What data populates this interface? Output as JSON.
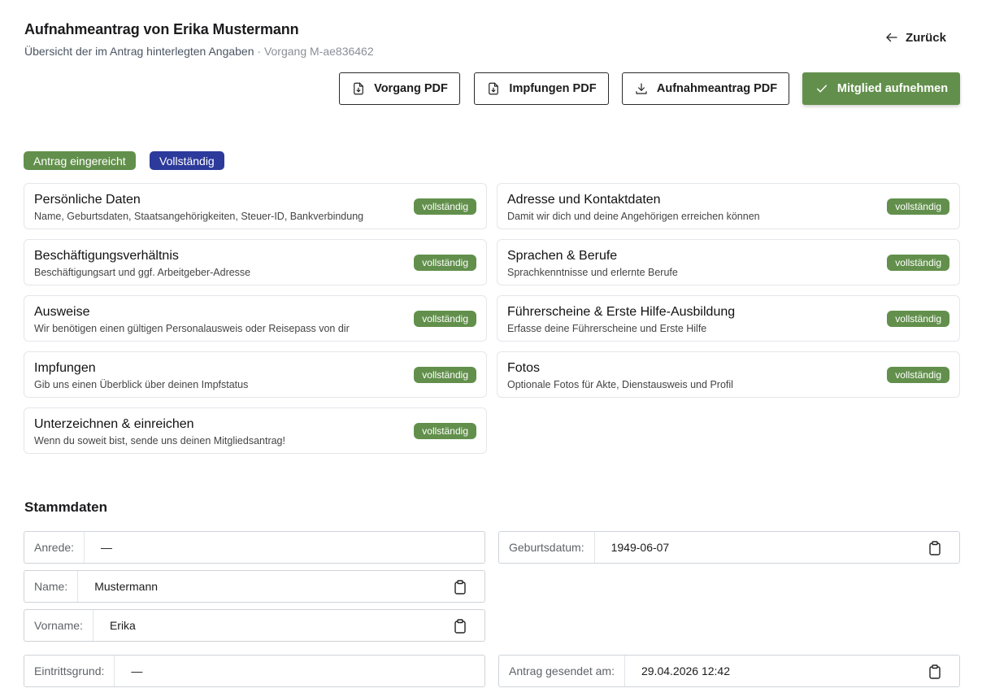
{
  "header": {
    "title": "Aufnahmeantrag von Erika Mustermann",
    "subtitle": "Übersicht der im Antrag hinterlegten Angaben",
    "reference": "· Vorgang M-ae836462",
    "back_label": "Zurück"
  },
  "actions": {
    "vorgang_pdf": "Vorgang PDF",
    "impfungen_pdf": "Impfungen PDF",
    "aufnahmeantrag_pdf": "Aufnahmeantrag PDF",
    "aufnehmen": "Mitglied aufnehmen"
  },
  "badges": {
    "status": "Antrag eingereicht",
    "completeness": "Vollständig"
  },
  "colors": {
    "accent_green": "#62904c",
    "badge_blue": "#2c3a9c"
  },
  "sections": [
    {
      "title": "Persönliche Daten",
      "description": "Name, Geburtsdaten, Staatsangehörigkeiten, Steuer-ID, Bankverbindung",
      "status": "vollständig"
    },
    {
      "title": "Adresse und Kontaktdaten",
      "description": "Damit wir dich und deine Angehörigen erreichen können",
      "status": "vollständig"
    },
    {
      "title": "Beschäftigungsverhältnis",
      "description": "Beschäftigungsart und ggf. Arbeitgeber-Adresse",
      "status": "vollständig"
    },
    {
      "title": "Sprachen & Berufe",
      "description": "Sprachkenntnisse und erlernte Berufe",
      "status": "vollständig"
    },
    {
      "title": "Ausweise",
      "description": "Wir benötigen einen gültigen Personalausweis oder Reisepass von dir",
      "status": "vollständig"
    },
    {
      "title": "Führerscheine & Erste Hilfe-Ausbildung",
      "description": "Erfasse deine Führerscheine und Erste Hilfe",
      "status": "vollständig"
    },
    {
      "title": "Impfungen",
      "description": "Gib uns einen Überblick über deinen Impfstatus",
      "status": "vollständig"
    },
    {
      "title": "Fotos",
      "description": "Optionale Fotos für Akte, Dienstausweis und Profil",
      "status": "vollständig"
    },
    {
      "title": "Unterzeichnen & einreichen",
      "description": "Wenn du soweit bist, sende uns deinen Mitgliedsantrag!",
      "status": "vollständig"
    }
  ],
  "stammdaten": {
    "title": "Stammdaten",
    "anrede": {
      "label": "Anrede:",
      "value": "—"
    },
    "name": {
      "label": "Name:",
      "value": "Mustermann"
    },
    "vorname": {
      "label": "Vorname:",
      "value": "Erika"
    },
    "geburtsdatum": {
      "label": "Geburtsdatum:",
      "value": "1949-06-07"
    },
    "eintrittsgrund": {
      "label": "Eintrittsgrund:",
      "value": "—"
    },
    "antrag_gesendet": {
      "label": "Antrag gesendet am:",
      "value": "29.04.2026 12:42"
    }
  }
}
